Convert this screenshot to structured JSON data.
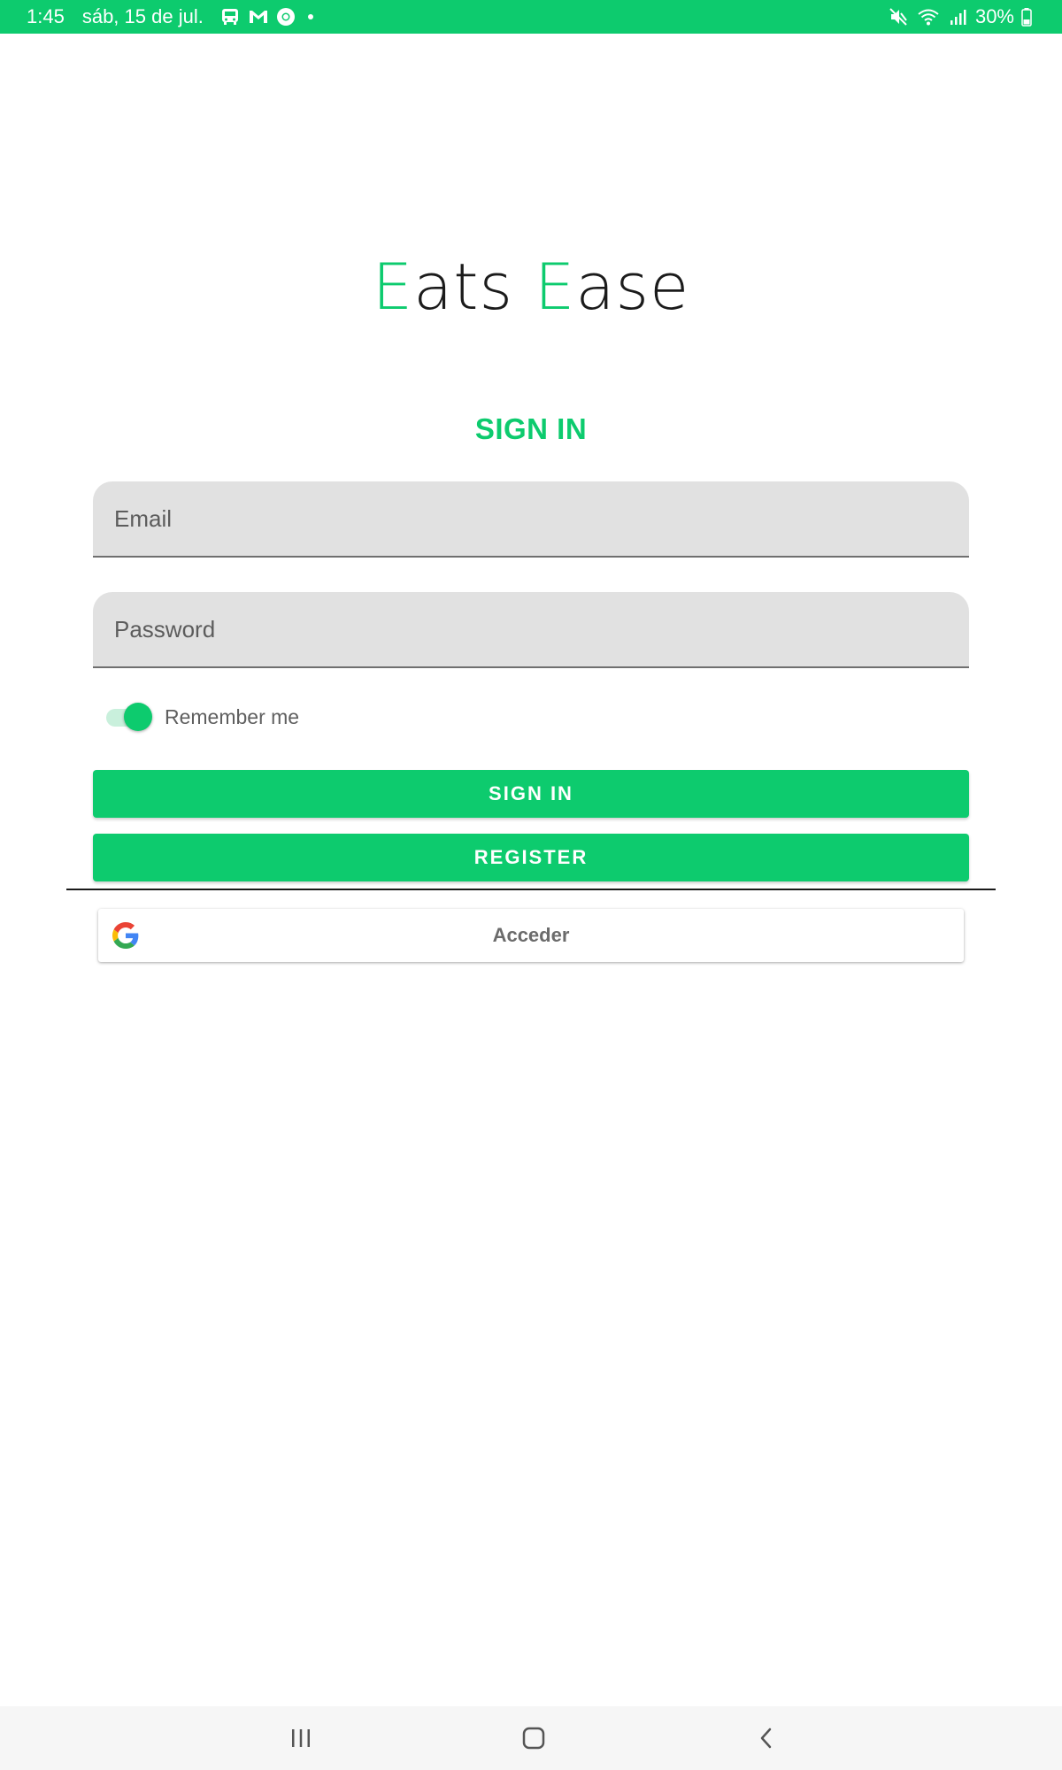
{
  "status_bar": {
    "time": "1:45",
    "date": "sáb, 15 de jul.",
    "battery": "30%",
    "left_icons": [
      "bus-icon",
      "gmail-icon",
      "chrome-icon",
      "dot-icon"
    ],
    "right_icons": [
      "mute-icon",
      "wifi-icon",
      "signal-icon",
      "battery-icon"
    ]
  },
  "logo": {
    "accent1": "E",
    "rest1": "ats ",
    "accent2": "E",
    "rest2": "ase"
  },
  "title": "SIGN IN",
  "form": {
    "email_placeholder": "Email",
    "password_placeholder": "Password",
    "remember_label": "Remember me",
    "remember_checked": true
  },
  "buttons": {
    "sign_in": "SIGN IN",
    "register": "REGISTER",
    "google": "Acceder"
  },
  "colors": {
    "accent": "#0dcb6e",
    "input_bg": "#e1e1e1"
  },
  "nav_bar": {
    "icons": [
      "recents-icon",
      "home-icon",
      "back-icon"
    ]
  }
}
